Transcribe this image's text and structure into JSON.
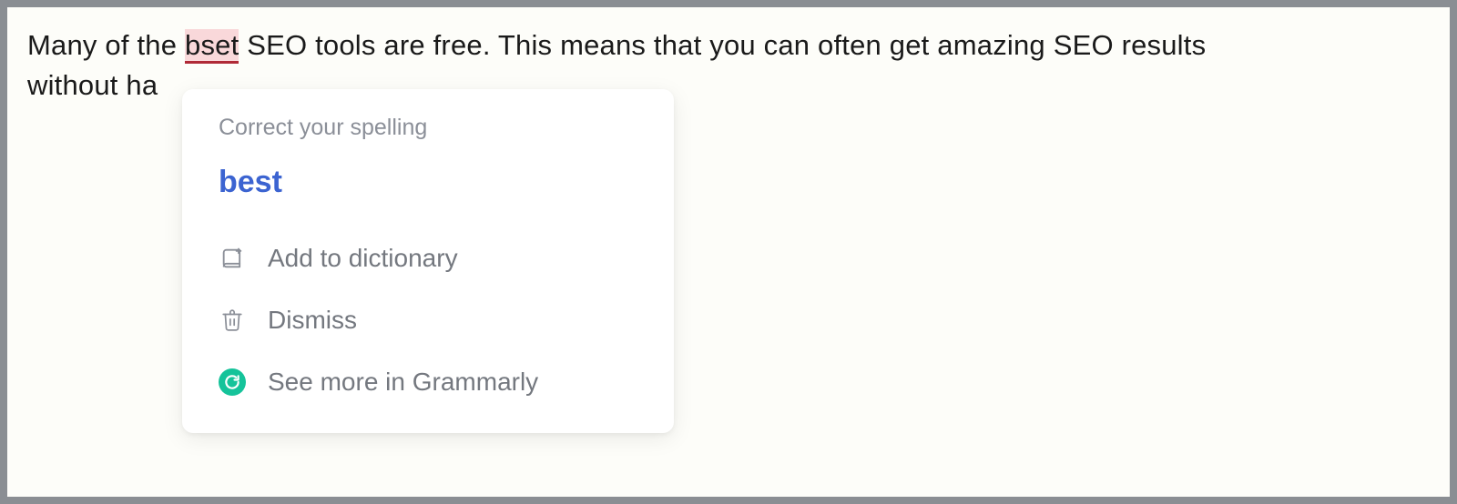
{
  "document": {
    "text_before": "Many of the ",
    "misspelled_word": "bset",
    "text_after_line1": " SEO tools are free. This means that you can often get amazing SEO results",
    "text_line2_visible": "without ha"
  },
  "popup": {
    "header": "Correct your spelling",
    "suggestion": "best",
    "add_to_dictionary": "Add to dictionary",
    "dismiss": "Dismiss",
    "see_more": "See more in Grammarly"
  },
  "colors": {
    "suggestion_blue": "#3c64d1",
    "error_highlight_bg": "#f9d8da",
    "error_underline": "#b02a37",
    "grammarly_green": "#15c39a"
  }
}
